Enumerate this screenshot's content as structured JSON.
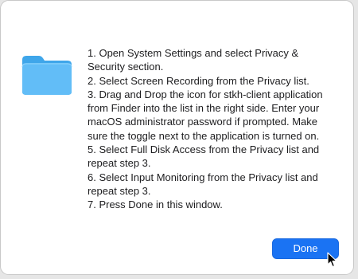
{
  "dialog": {
    "icon": "folder-icon",
    "instructions": [
      "1. Open System Settings and select Privacy & Security section.",
      "2. Select Screen Recording from the Privacy list.",
      "3. Drag and Drop the icon for stkh-client application from Finder into the list in the right side. Enter your macOS administrator password if prompted. Make sure the toggle next to the application is turned on.",
      "5. Select Full Disk Access from the Privacy list and repeat step 3.",
      "6. Select Input Monitoring from the Privacy list and repeat step 3.",
      "7. Press Done in this window."
    ],
    "done_label": "Done"
  },
  "cursor": "arrow-cursor-icon",
  "colors": {
    "accent": "#1a73f3",
    "folder": "#5bb8f5",
    "text": "#1d1d1f",
    "background": "#ffffff"
  }
}
